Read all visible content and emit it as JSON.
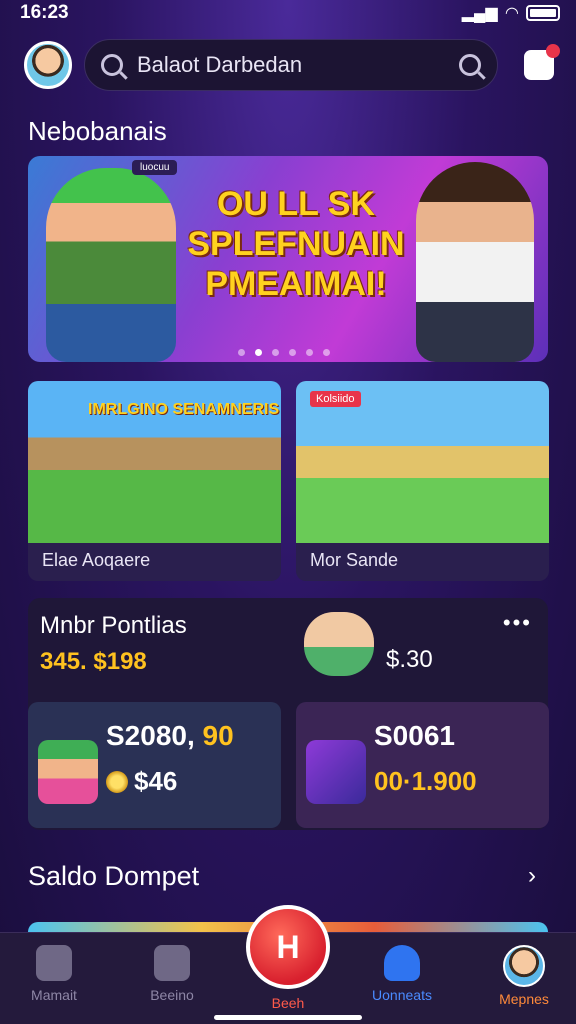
{
  "status": {
    "time": "16:23"
  },
  "search": {
    "placeholder": "Balaot Darbedan"
  },
  "section": {
    "title": "Nebobanais"
  },
  "banner": {
    "tag": "luocuu",
    "headline_1": "OU LL SK",
    "headline_2": "SPLEFNUAIN",
    "headline_3": "PMEAIMAI!",
    "slides": 6,
    "active_slide": 2
  },
  "games": [
    {
      "art_title": "IMRLGINO SENAMNERIS",
      "label": "Elae Aoqaere"
    },
    {
      "chip": "Kolsiido",
      "label": "Mor Sande"
    }
  ],
  "panel": {
    "title": "Mnbr Pontlias",
    "amount": "345. $198",
    "price": "$.30",
    "more": "•••"
  },
  "mini_cards": [
    {
      "big_a": "S2080,",
      "big_b": "90",
      "sub": "$46"
    },
    {
      "big": "S0061",
      "sub": "00·1.900"
    }
  ],
  "saldo": {
    "title": "Saldo Dompet",
    "chevron": "›"
  },
  "nav": [
    {
      "label": "Mamait"
    },
    {
      "label": "Beeino"
    },
    {
      "label": "Beeh",
      "fab": "H"
    },
    {
      "label": "Uonneats"
    },
    {
      "label": "Mepnes"
    }
  ],
  "colors": {
    "accent": "#ffc21f",
    "active_nav": "#4a8bff",
    "fab": "#d8202e"
  }
}
